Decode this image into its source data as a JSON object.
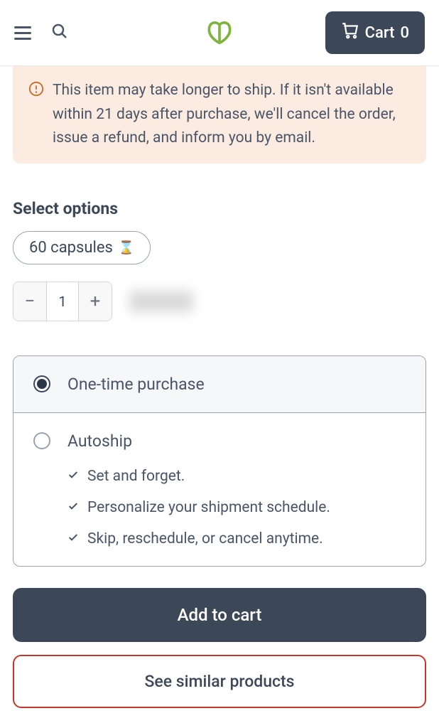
{
  "header": {
    "cart_label": "Cart",
    "cart_count": "0"
  },
  "notice": {
    "text": "This item may take longer to ship. If it isn't available within 21 days after purchase, we'll cancel the order, issue a refund, and inform you by email."
  },
  "options": {
    "title": "Select options",
    "variant": "60 capsules"
  },
  "quantity": {
    "value": "1"
  },
  "purchase": {
    "one_time_label": "One-time purchase",
    "autoship_label": "Autoship",
    "features": [
      "Set and forget.",
      "Personalize your shipment schedule.",
      "Skip, reschedule, or cancel anytime."
    ]
  },
  "buttons": {
    "add_to_cart": "Add to cart",
    "similar": "See similar products"
  }
}
